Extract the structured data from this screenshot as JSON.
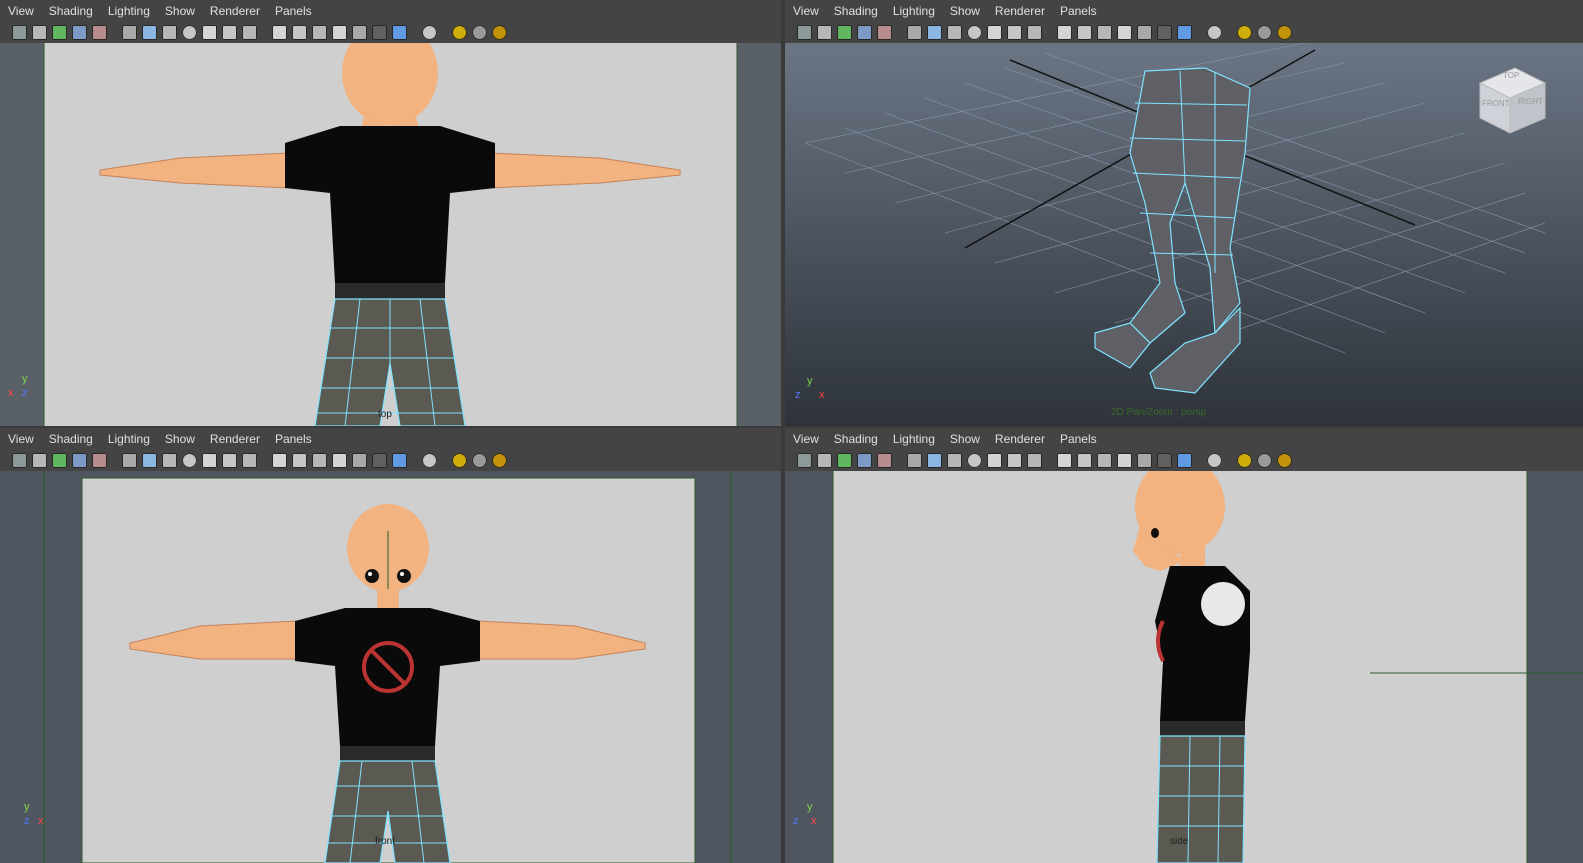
{
  "menus": [
    "View",
    "Shading",
    "Lighting",
    "Show",
    "Renderer",
    "Panels"
  ],
  "panels": {
    "top_left": {
      "camera_label": "top"
    },
    "top_right": {
      "hud_text": "2D Pan/Zoom : persp",
      "viewcube": {
        "top": "TOP",
        "front": "FRONT",
        "right": "RIGHT"
      }
    },
    "bottom_left": {
      "camera_label": "front"
    },
    "bottom_right": {
      "camera_label": "side"
    }
  },
  "axes": {
    "x": "x",
    "y": "y",
    "z": "z"
  },
  "colors": {
    "panel_bg": "#444444",
    "viewport_gray": "#cfcfcf",
    "persp_top": "#6b7584",
    "persp_bottom": "#2e333a",
    "wire": "#7fe3ff",
    "skin": "#f2b380",
    "shirt": "#0a0a0a",
    "pants": "#5a5a52"
  },
  "toolbar_icons": [
    "camera-icon",
    "camera-attr-icon",
    "bookmark-icon",
    "image-plane-icon",
    "grid-icon",
    "wireframe-icon",
    "smooth-shade-icon",
    "shade-all-icon",
    "textured-icon",
    "lights-icon",
    "shadows-icon",
    "isolate-icon",
    "ao-icon",
    "xray-icon",
    "xray-joints-icon",
    "backface-icon",
    "default-light-icon",
    "all-lights-icon",
    "select-camera-icon",
    "resolution-gate-icon",
    "film-gate-icon",
    "field-chart-icon",
    "safe-action-icon"
  ]
}
